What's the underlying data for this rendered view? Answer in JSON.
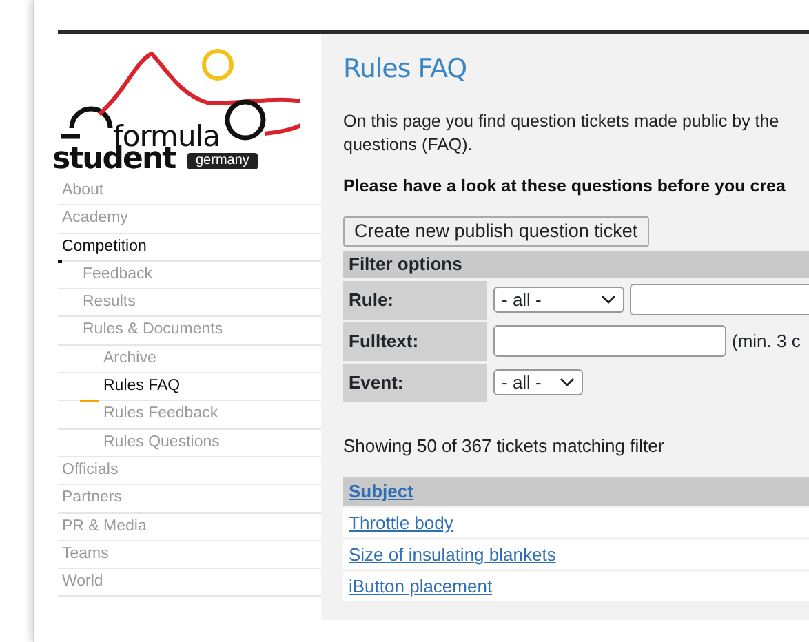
{
  "logo": {
    "line1": "formula",
    "line2": "student",
    "tag": "germany"
  },
  "sidebar": {
    "items": [
      {
        "label": "About",
        "selected": false
      },
      {
        "label": "Academy",
        "selected": false
      },
      {
        "label": "Competition",
        "selected": true,
        "children": [
          {
            "label": "Feedback",
            "selected": false
          },
          {
            "label": "Results",
            "selected": false
          },
          {
            "label": "Rules & Documents",
            "selected": false,
            "children": [
              {
                "label": "Archive",
                "selected": false
              },
              {
                "label": "Rules FAQ",
                "selected": true
              },
              {
                "label": "Rules Feedback",
                "selected": false
              },
              {
                "label": "Rules Questions",
                "selected": false
              }
            ]
          }
        ]
      },
      {
        "label": "Officials",
        "selected": false
      },
      {
        "label": "Partners",
        "selected": false
      },
      {
        "label": "PR & Media",
        "selected": false
      },
      {
        "label": "Teams",
        "selected": false
      },
      {
        "label": "World",
        "selected": false
      }
    ]
  },
  "page": {
    "title": "Rules FAQ",
    "intro": "On this page you find question tickets made public by the\nquestions (FAQ).",
    "notice": "Please have a look at these questions before you crea",
    "button": "Create new publish question ticket"
  },
  "filter": {
    "title": "Filter options",
    "rows": [
      {
        "label": "Rule:",
        "kind": "select_input",
        "select": "- all -"
      },
      {
        "label": "Fulltext:",
        "kind": "input_hint",
        "hint": "(min. 3 c"
      },
      {
        "label": "Event:",
        "kind": "select",
        "select": "- all -"
      }
    ]
  },
  "result_count": "Showing 50 of 367 tickets matching filter",
  "table": {
    "columns": [
      "Subject"
    ],
    "rows": [
      "Throttle body",
      "Size of insulating blankets",
      "iButton placement"
    ]
  }
}
